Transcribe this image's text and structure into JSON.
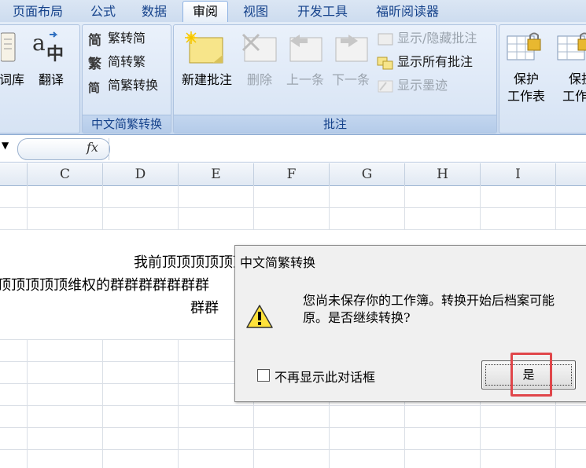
{
  "tabs": [
    "页面布局",
    "公式",
    "数据",
    "审阅",
    "视图",
    "开发工具",
    "福昕阅读器"
  ],
  "active_tab": "审阅",
  "ribbon": {
    "proofing": {
      "thesaurus_label": "词库",
      "translate_label": "翻译"
    },
    "chinese_conversion": {
      "group_label": "中文简繁转换",
      "items": [
        "繁转简",
        "简转繁",
        "简繁转换"
      ]
    },
    "comments": {
      "group_label": "批注",
      "new_comment": "新建批注",
      "delete": "删除",
      "previous": "上一条",
      "next": "下一条",
      "show_hide": "显示/隐藏批注",
      "show_all": "显示所有批注",
      "show_ink": "显示墨迹"
    },
    "changes": {
      "protect_sheet_line1": "保护",
      "protect_sheet_line2": "工作表",
      "protect_workbook_line1": "保护",
      "protect_workbook_line2": "工作簿"
    }
  },
  "formula_bar": {
    "fx_label": "fx"
  },
  "columns": [
    "C",
    "D",
    "E",
    "F",
    "G",
    "H",
    "I"
  ],
  "cell_text": {
    "line1": "我前顶顶顶顶顶顶顶顶",
    "line2": "顶顶顶顶顶维权的群群群群群群群",
    "line3": "群群"
  },
  "dialog": {
    "title": "中文简繁转换",
    "message_line1": "您尚未保存你的工作簿。转换开始后档案可能",
    "message_line2": "原。是否继续转换?",
    "checkbox_label": "不再显示此对话框",
    "yes_label": "是"
  },
  "colors": {
    "highlight": "#e0464a",
    "tab_text": "#15428b"
  }
}
